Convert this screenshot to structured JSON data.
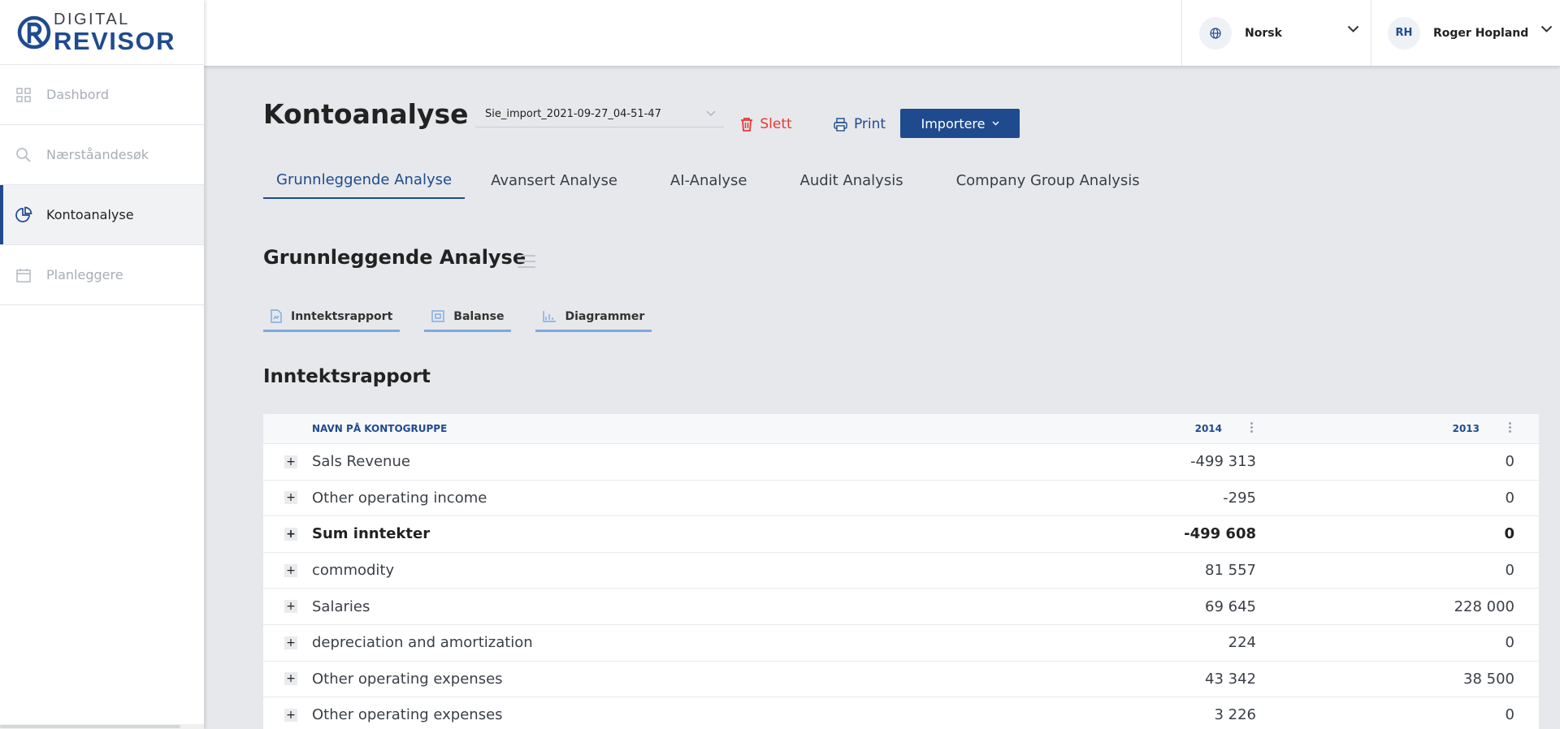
{
  "brand": {
    "line1": "DIGITAL",
    "line2": "REVISOR"
  },
  "sidebar": {
    "items": [
      {
        "label": "Dashbord",
        "icon": "grid-icon"
      },
      {
        "label": "Nærståandesøk",
        "icon": "search-icon"
      },
      {
        "label": "Kontoanalyse",
        "icon": "pie-chart-icon",
        "active": true
      },
      {
        "label": "Planleggere",
        "icon": "calendar-icon"
      }
    ]
  },
  "header": {
    "language": "Norsk",
    "user": {
      "initials": "RH",
      "name": "Roger Hopland"
    }
  },
  "page": {
    "title": "Kontoanalyse",
    "file": "Sie_import_2021-09-27_04-51-47",
    "delete_label": "Slett",
    "print_label": "Print",
    "import_label": "Importere"
  },
  "tabs": [
    {
      "label": "Grunnleggende Analyse",
      "active": true
    },
    {
      "label": "Avansert Analyse"
    },
    {
      "label": "AI-Analyse"
    },
    {
      "label": "Audit Analysis"
    },
    {
      "label": "Company Group Analysis"
    }
  ],
  "section": {
    "title": "Grunnleggende Analyse"
  },
  "subtabs": [
    {
      "label": "Inntektsrapport",
      "icon": "document-icon"
    },
    {
      "label": "Balanse",
      "icon": "balance-icon"
    },
    {
      "label": "Diagrammer",
      "icon": "bar-chart-icon"
    }
  ],
  "report": {
    "title": "Inntektsrapport",
    "columns": {
      "name": "NAVN PÅ KONTOGRUPPE",
      "y2014": "2014",
      "y2013": "2013"
    },
    "rows": [
      {
        "name": "Sals Revenue",
        "y2014": "-499 313",
        "y2013": "0"
      },
      {
        "name": "Other operating income",
        "y2014": "-295",
        "y2013": "0"
      },
      {
        "name": "Sum inntekter",
        "y2014": "-499 608",
        "y2013": "0",
        "bold": true
      },
      {
        "name": "commodity",
        "y2014": "81 557",
        "y2013": "0"
      },
      {
        "name": "Salaries",
        "y2014": "69 645",
        "y2013": "228 000"
      },
      {
        "name": "depreciation and amortization",
        "y2014": "224",
        "y2013": "0"
      },
      {
        "name": "Other operating expenses",
        "y2014": "43 342",
        "y2013": "38 500"
      },
      {
        "name": "Other operating expenses",
        "y2014": "3 226",
        "y2013": "0"
      }
    ]
  },
  "colors": {
    "brand": "#1f4b8e",
    "danger": "#e53935",
    "accent": "#7fa8e0"
  }
}
